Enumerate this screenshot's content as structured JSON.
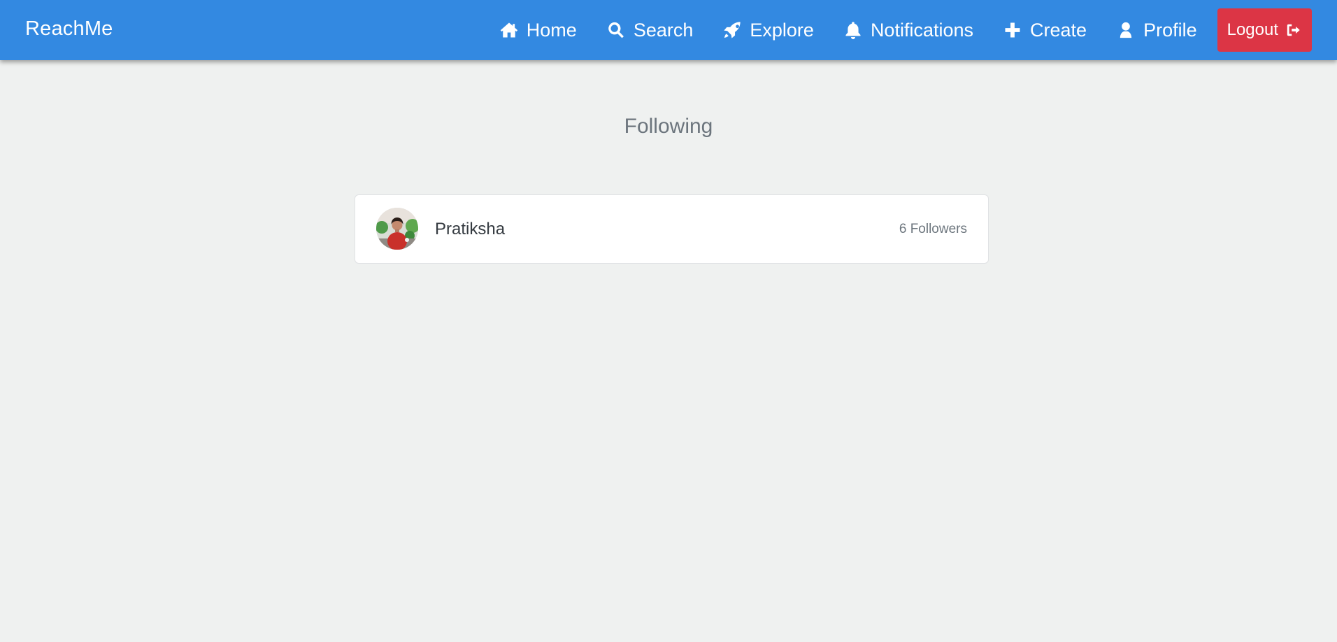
{
  "navbar": {
    "brand": "ReachMe",
    "background_color": "#3389e1",
    "links": [
      {
        "label": "Home",
        "icon": "home-icon"
      },
      {
        "label": "Search",
        "icon": "search-icon"
      },
      {
        "label": "Explore",
        "icon": "rocket-icon"
      },
      {
        "label": "Notifications",
        "icon": "bell-icon"
      },
      {
        "label": "Create",
        "icon": "plus-icon"
      },
      {
        "label": "Profile",
        "icon": "user-icon"
      }
    ],
    "logout": {
      "label": "Logout",
      "icon": "sign-out-icon",
      "color": "#dc3545"
    }
  },
  "main": {
    "title": "Following",
    "users": [
      {
        "name": "Pratiksha",
        "followers": "6 Followers",
        "avatar": "avatar-image"
      }
    ]
  }
}
